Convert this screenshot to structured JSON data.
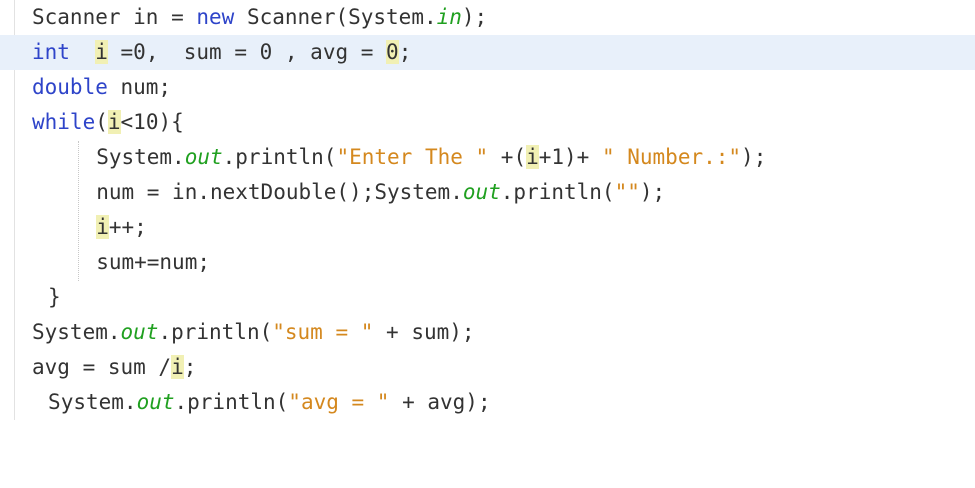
{
  "editor": {
    "lines": [
      {
        "tokens": [
          {
            "t": "Scanner in = ",
            "c": "plain"
          },
          {
            "t": "new",
            "c": "kw"
          },
          {
            "t": " Scanner(System.",
            "c": "plain"
          },
          {
            "t": "in",
            "c": "fld"
          },
          {
            "t": ");",
            "c": "plain"
          }
        ]
      },
      {
        "current": true,
        "tokens": [
          {
            "t": "int",
            "c": "kw"
          },
          {
            "t": "  ",
            "c": "plain"
          },
          {
            "t": "i",
            "c": "plain",
            "hl": true
          },
          {
            "t": " =0,  sum = 0 , avg = ",
            "c": "plain"
          },
          {
            "t": "0",
            "c": "plain",
            "hl": true
          },
          {
            "t": ";",
            "c": "plain"
          }
        ]
      },
      {
        "tokens": [
          {
            "t": "double",
            "c": "kw"
          },
          {
            "t": " num;",
            "c": "plain"
          }
        ]
      },
      {
        "tokens": [
          {
            "t": "while",
            "c": "kw"
          },
          {
            "t": "(",
            "c": "plain"
          },
          {
            "t": "i",
            "c": "plain",
            "hl": true
          },
          {
            "t": "<10){",
            "c": "plain"
          }
        ]
      },
      {
        "indent": 4,
        "tokens": [
          {
            "t": "System.",
            "c": "plain"
          },
          {
            "t": "out",
            "c": "fld"
          },
          {
            "t": ".println(",
            "c": "plain"
          },
          {
            "t": "\"Enter The \"",
            "c": "str"
          },
          {
            "t": " +(",
            "c": "plain"
          },
          {
            "t": "i",
            "c": "plain",
            "hl": true
          },
          {
            "t": "+1)+ ",
            "c": "plain"
          },
          {
            "t": "\" Number.:\"",
            "c": "str"
          },
          {
            "t": ");",
            "c": "plain"
          }
        ]
      },
      {
        "indent": 4,
        "tokens": [
          {
            "t": "num = in.nextDouble();System.",
            "c": "plain"
          },
          {
            "t": "out",
            "c": "fld"
          },
          {
            "t": ".println(",
            "c": "plain"
          },
          {
            "t": "\"\"",
            "c": "str"
          },
          {
            "t": ");",
            "c": "plain"
          }
        ]
      },
      {
        "indent": 4,
        "tokens": [
          {
            "t": "i",
            "c": "plain",
            "hl": true
          },
          {
            "t": "++;",
            "c": "plain"
          }
        ]
      },
      {
        "indent": 4,
        "tokens": [
          {
            "t": "sum+=num;",
            "c": "plain"
          }
        ]
      },
      {
        "indent": 1,
        "tokens": [
          {
            "t": "}",
            "c": "plain"
          }
        ]
      },
      {
        "tokens": [
          {
            "t": "System.",
            "c": "plain"
          },
          {
            "t": "out",
            "c": "fld"
          },
          {
            "t": ".println(",
            "c": "plain"
          },
          {
            "t": "\"sum = \"",
            "c": "str"
          },
          {
            "t": " + sum);",
            "c": "plain"
          }
        ]
      },
      {
        "tokens": [
          {
            "t": "avg = sum /",
            "c": "plain"
          },
          {
            "t": "i",
            "c": "plain",
            "hl": true
          },
          {
            "t": ";",
            "c": "plain"
          }
        ]
      },
      {
        "indent": 1,
        "tokens": [
          {
            "t": "System.",
            "c": "plain"
          },
          {
            "t": "out",
            "c": "fld"
          },
          {
            "t": ".println(",
            "c": "plain"
          },
          {
            "t": "\"avg = \"",
            "c": "str"
          },
          {
            "t": " + avg);",
            "c": "plain"
          }
        ]
      }
    ]
  },
  "colors": {
    "keyword": "#2e44c9",
    "field": "#20a020",
    "string": "#d4881e",
    "text": "#333333",
    "occurrence_highlight": "#f1f0b4",
    "current_line": "#e8f0fa"
  }
}
